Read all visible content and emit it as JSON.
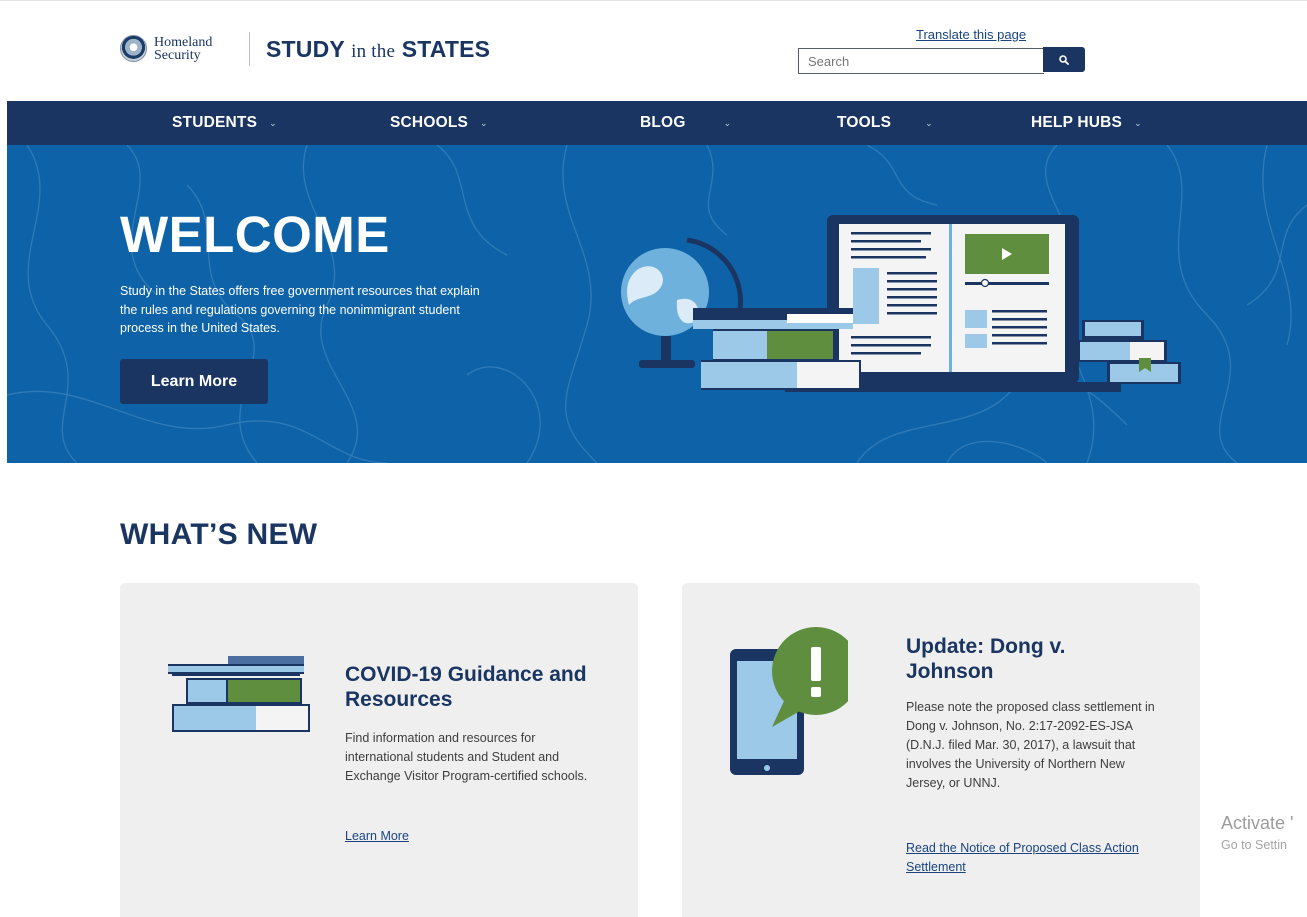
{
  "header": {
    "dhs_logo_line1": "Homeland",
    "dhs_logo_line2": "Security",
    "site_logo_study": "STUDY",
    "site_logo_in_the": "in the",
    "site_logo_states": "STATES",
    "translate_link": "Translate this page",
    "search_placeholder": "Search"
  },
  "nav": {
    "items": [
      {
        "label": "STUDENTS"
      },
      {
        "label": "SCHOOLS"
      },
      {
        "label": "BLOG"
      },
      {
        "label": "TOOLS"
      },
      {
        "label": "HELP HUBS"
      }
    ]
  },
  "hero": {
    "title": "WELCOME",
    "description": "Study in the States offers free government resources that explain the rules and regulations governing the nonimmigrant student process in the United States.",
    "button_label": "Learn More"
  },
  "whats_new": {
    "title": "WHAT’S NEW",
    "cards": [
      {
        "title": "COVID-19 Guidance and Resources",
        "text": "Find information and resources for international students and Student and Exchange Visitor Program-certified schools.",
        "link": "Learn More",
        "icon": "books-icon"
      },
      {
        "title": "Update: Dong v. Johnson",
        "text": "Please note the proposed class settlement in Dong v. Johnson, No. 2:17-2092-ES-JSA (D.N.J. filed Mar. 30, 2017), a lawsuit that involves the University of Northern New Jersey, or UNNJ.",
        "link": "Read the Notice of Proposed Class Action Settlement",
        "icon": "phone-alert-icon"
      }
    ]
  },
  "os_watermark": {
    "line1": "Activate '",
    "line2": "Go to Settin"
  },
  "colors": {
    "navy": "#1a3561",
    "hero_blue": "#0e63a8",
    "card_bg": "#efefef",
    "accent_green": "#5e8e3e",
    "link_blue": "#1a4480"
  }
}
